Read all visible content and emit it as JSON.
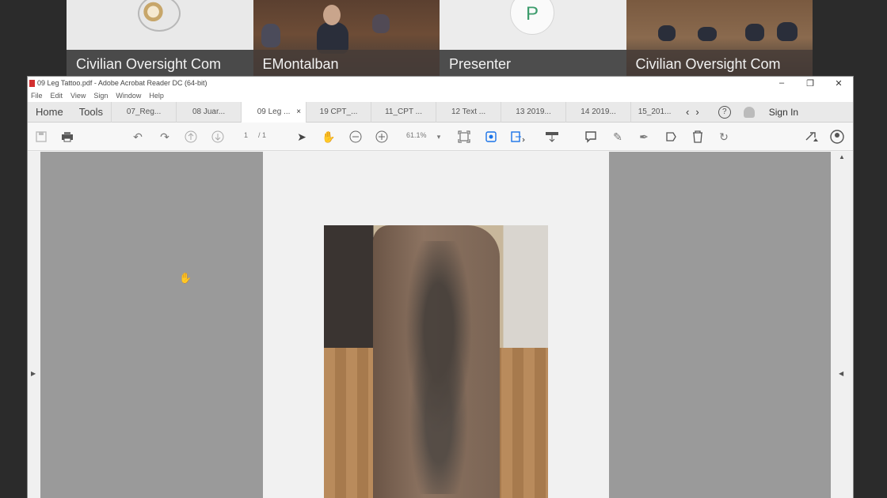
{
  "gallery": {
    "tiles": [
      {
        "name": "Civilian Oversight Com"
      },
      {
        "name": "EMontalban"
      },
      {
        "name": "Presenter",
        "avatar_letter": "P"
      },
      {
        "name": "Civilian Oversight Com"
      }
    ]
  },
  "window": {
    "title": "09 Leg Tattoo.pdf - Adobe Acrobat Reader DC (64-bit)",
    "controls": {
      "minimize": "–",
      "restore": "❐",
      "close": "✕"
    }
  },
  "menu": [
    "File",
    "Edit",
    "View",
    "Sign",
    "Window",
    "Help"
  ],
  "tabbar": {
    "home": "Home",
    "tools": "Tools",
    "tabs": [
      "07_Reg...",
      "08 Juar...",
      "09 Leg ...",
      "19 CPT_...",
      "11_CPT ...",
      "12 Text ...",
      "13 2019...",
      "14 2019...",
      "15_201..."
    ],
    "active_index": 2,
    "close_glyph": "×",
    "prev": "‹",
    "next": "›",
    "help": "?",
    "sign_in": "Sign In"
  },
  "toolbar": {
    "page_current": "1",
    "page_total": "/ 1",
    "zoom": "61.1%"
  },
  "icons": [
    "save-icon",
    "print-icon",
    "undo-icon",
    "redo-icon",
    "page-up-icon",
    "page-down-icon",
    "select-arrow-icon",
    "hand-icon",
    "zoom-out-icon",
    "zoom-in-icon",
    "fit-page-icon",
    "scan-icon",
    "export-icon",
    "redact-icon",
    "comment-icon",
    "highlight-icon",
    "sign-icon",
    "stamp-icon",
    "delete-icon",
    "rotate-icon",
    "share-link-icon",
    "account-icon"
  ],
  "colors": {
    "accent": "#1a73e8",
    "pdf_red": "#d32f2f",
    "presenter_green": "#3c9c6c"
  }
}
